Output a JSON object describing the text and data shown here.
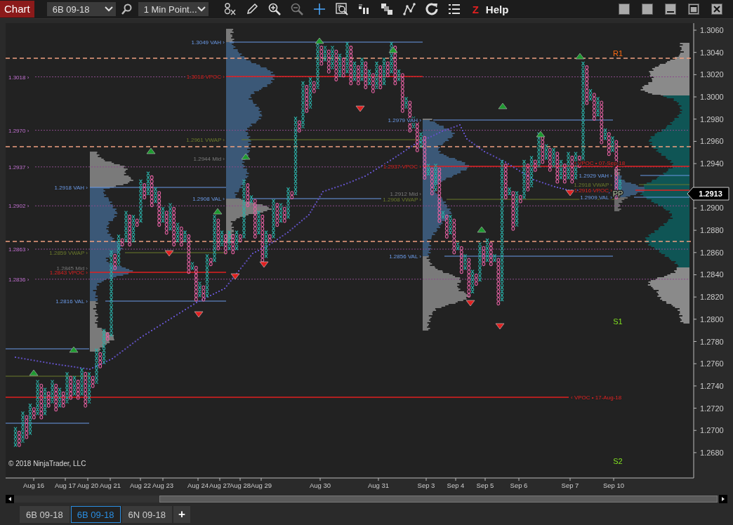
{
  "toolbar": {
    "title": "Chart",
    "instrument": "6B 09-18",
    "interval": "1 Min Point...",
    "z_glyph": "Z",
    "help": "Help"
  },
  "chart": {
    "price_ticks": [
      "1.3060",
      "1.3040",
      "1.3020",
      "1.3000",
      "1.2980",
      "1.2960",
      "1.2940",
      "1.2900",
      "1.2880",
      "1.2860",
      "1.2840",
      "1.2820",
      "1.2800",
      "1.2780",
      "1.2760",
      "1.2740",
      "1.2720",
      "1.2700",
      "1.2680"
    ],
    "current_price": "1.2913",
    "date_labels": [
      "Aug 16",
      "Aug 17",
      "Aug 20",
      "Aug 21",
      "Aug 22",
      "Aug 23",
      "Aug 24",
      "Aug 27",
      "Aug 28",
      "Aug 29",
      "Aug 30",
      "Aug 31",
      "Sep 3",
      "Sep 4",
      "Sep 5",
      "Sep 6",
      "Sep 7",
      "Sep 10"
    ],
    "reference_levels": [
      {
        "label": "1.3018 ›"
      },
      {
        "label": "1.2970 ›"
      },
      {
        "label": "1.2937 ›"
      },
      {
        "label": "1.2902 ›"
      },
      {
        "label": "1.2863 ›"
      },
      {
        "label": "1.2836 ›"
      }
    ],
    "session_levels": [
      {
        "kind": "vah",
        "label": "1.3049 VAH ›"
      },
      {
        "kind": "vpoc",
        "label": "1.3018 VPOC ›"
      },
      {
        "kind": "vwap",
        "label": "1.2961 VWAP ›"
      },
      {
        "kind": "mid",
        "label": "1.2944 Mid ›"
      },
      {
        "kind": "vah",
        "label": "1.2918 VAH ›"
      },
      {
        "kind": "val",
        "label": "1.2908 VAL ›"
      },
      {
        "kind": "vwap",
        "label": "1.2859 VWAP ›"
      },
      {
        "kind": "mid",
        "label": "1.2845 Mid ›"
      },
      {
        "kind": "vpoc",
        "label": "1.2843 VPOC ›"
      },
      {
        "kind": "val",
        "label": "1.2816 VAL ›"
      },
      {
        "kind": "vah",
        "label": "1.2979 VAH ›"
      },
      {
        "kind": "vpoc",
        "label": "1.2937 VPOC ›"
      },
      {
        "kind": "mid",
        "label": "1.2912 Mid ›"
      },
      {
        "kind": "vwap",
        "label": "1.2908 VWAP ›"
      },
      {
        "kind": "val",
        "label": "1.2856 VAL ›"
      },
      {
        "kind": "vah",
        "label": "1.2929 VAH ›"
      },
      {
        "kind": "vwap",
        "label": "1.2918 VWAP ›"
      },
      {
        "kind": "vpoc",
        "label": "1.2916 VPOC ›"
      },
      {
        "kind": "val",
        "label": "1.2909 VAL ›"
      }
    ],
    "naked_pocs": [
      {
        "label": "‹ VPOC • 07-Sep-18"
      },
      {
        "label": "‹ VPOC • 17-Aug-18"
      }
    ],
    "pivots": [
      {
        "kind": "resistance",
        "label": "R1"
      },
      {
        "kind": "pivot",
        "label": "PP"
      },
      {
        "kind": "support",
        "label": "S1"
      },
      {
        "kind": "support",
        "label": "S2"
      }
    ],
    "copyright": "© 2018 NinjaTrader, LLC"
  },
  "tabs": [
    {
      "label": "6B 09-18",
      "selected": false
    },
    {
      "label": "6B 09-18",
      "selected": true
    },
    {
      "label": "6N 09-18",
      "selected": false
    }
  ],
  "add_tab": "+"
}
